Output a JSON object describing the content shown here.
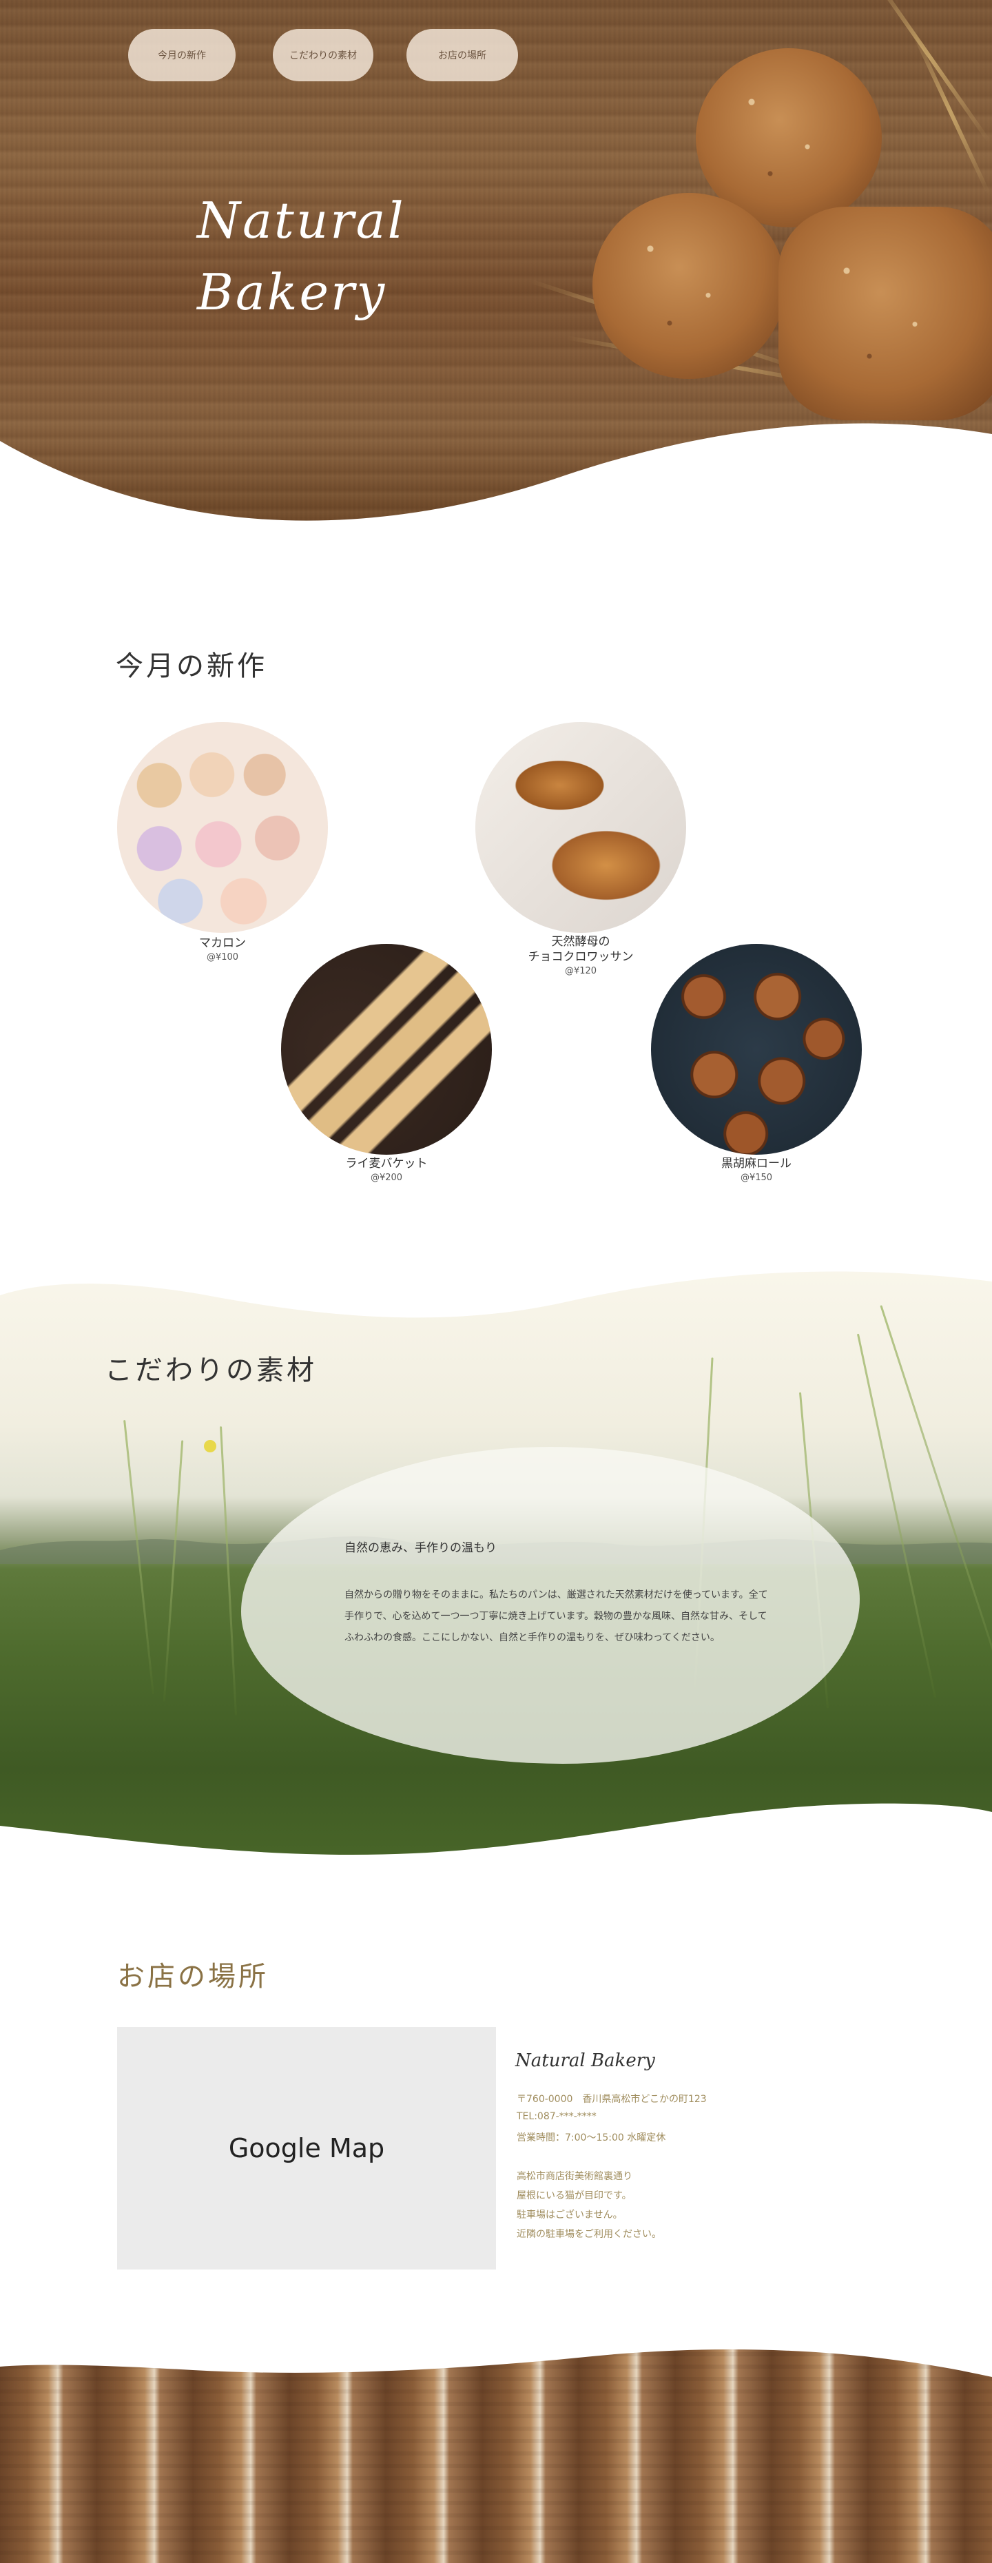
{
  "nav": {
    "items": [
      "今月の新作",
      "こだわりの素材",
      "お店の場所"
    ]
  },
  "hero": {
    "title": "Natural\nBakery"
  },
  "new_items": {
    "heading": "今月の新作",
    "items": [
      {
        "name": "マカロン",
        "price": "@¥100"
      },
      {
        "name": "天然酵母の\nチョコクロワッサン",
        "price": "@¥120"
      },
      {
        "name": "ライ麦バケット",
        "price": "@¥200"
      },
      {
        "name": "黒胡麻ロール",
        "price": "@¥150"
      }
    ]
  },
  "materials": {
    "heading": "こだわりの素材",
    "subheading": "自然の恵み、手作りの温もり",
    "body": "自然からの贈り物をそのままに。私たちのパンは、厳選された天然素材だけを使っています。全て手作りで、心を込めて一つ一つ丁寧に焼き上げています。穀物の豊かな風味、自然な甘み、そしてふわふわの食感。ここにしかない、自然と手作りの温もりを、ぜひ味わってください。"
  },
  "shop": {
    "heading": "お店の場所",
    "map_label": "Google Map",
    "name": "Natural Bakery",
    "address": "〒760-0000　香川県高松市どこかの町123",
    "tel": "TEL:087-***-****",
    "hours": "営業時間：7:00〜15:00 水曜定休",
    "notes": [
      "高松市商店街美術館裏通り",
      "屋根にいる猫が目印です。",
      "駐車場はございません。",
      "近隣の駐車場をご利用ください。"
    ]
  },
  "colors": {
    "accent_text": "#8a7245",
    "info_text": "#a08d5e",
    "nav_pill": "#f5e9dc"
  }
}
